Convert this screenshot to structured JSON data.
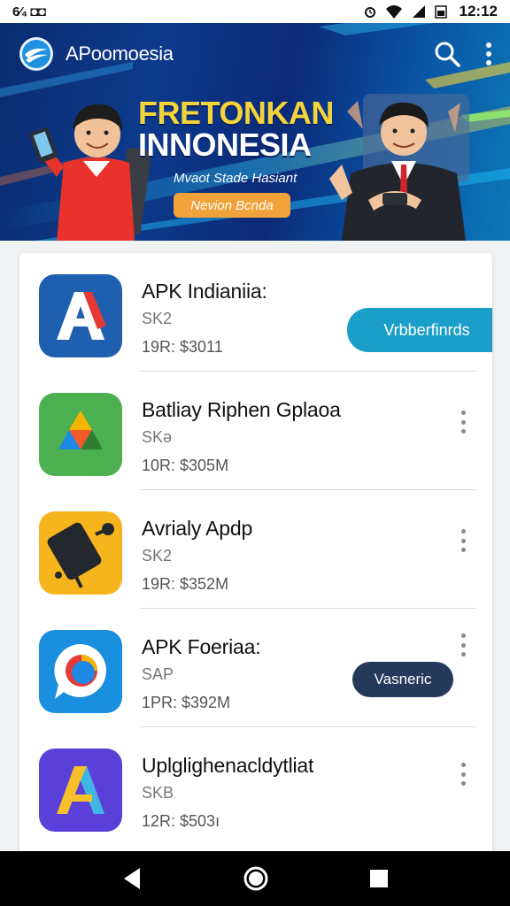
{
  "status_bar": {
    "left_text": "6⁄₄ ◘◘",
    "time": "12:12"
  },
  "header": {
    "app_title": "APoomoesia",
    "icons": [
      "search-icon",
      "more-vert-icon"
    ]
  },
  "banner": {
    "title_line1": "FRETONKAN",
    "title_line2": "INNONESIA",
    "subtitle": "Mvaot Stade Hasiant",
    "button_label": "Nevion Bcnda"
  },
  "apps": [
    {
      "name": "APK Indianiia:",
      "size": "SK2",
      "meta": "19R: $3011",
      "action": "Vrbberfinrds"
    },
    {
      "name": "Batliay Riphen Gplaoa",
      "size": "SKə",
      "meta": "10R: $305M",
      "action": ""
    },
    {
      "name": "Avrialy Apdp",
      "size": "SK2",
      "meta": "19R: $352M",
      "action": ""
    },
    {
      "name": "APK Foeriaa:",
      "size": "SAP",
      "meta": "1PR: $392M",
      "action": "Vasneric"
    },
    {
      "name": "Uplglighenacldytliat",
      "size": "SKB",
      "meta": "12R: $503ı",
      "action": ""
    }
  ],
  "colors": {
    "accent_teal": "#1b9fc8",
    "accent_navy": "#253a5a",
    "banner_yellow": "#f3d43a",
    "banner_button": "#f2a23a"
  },
  "navbar": {
    "icons": [
      "back-icon",
      "home-icon",
      "recents-icon"
    ]
  }
}
